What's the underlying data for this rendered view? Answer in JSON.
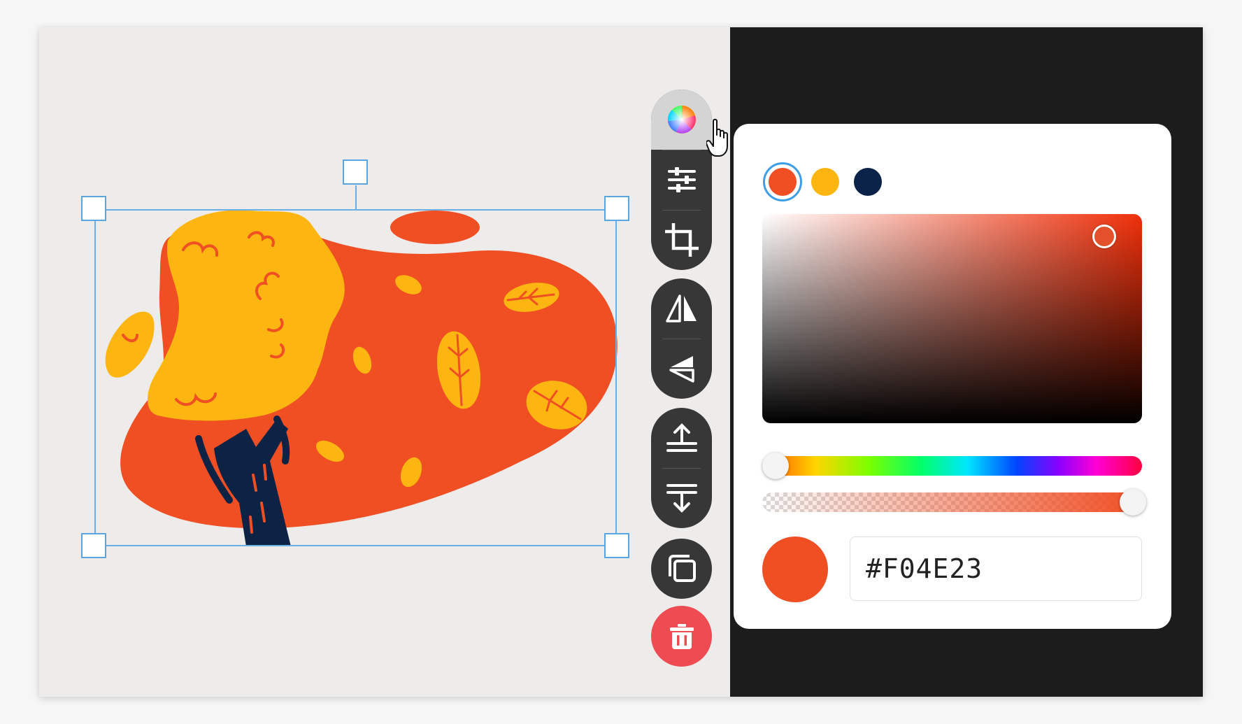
{
  "color_picker": {
    "swatches": [
      {
        "name": "orange",
        "color": "#F04E23",
        "selected": true
      },
      {
        "name": "yellow",
        "color": "#FDB611"
      },
      {
        "name": "navy",
        "color": "#0B2348"
      }
    ],
    "hex_value": "#F04E23",
    "current_color": "#F04E23",
    "hue_level": 0.0,
    "alpha_level": 1.0
  },
  "toolbar": {
    "tools": [
      {
        "id": "color",
        "icon": "color-wheel-icon",
        "active": true
      },
      {
        "id": "adjust",
        "icon": "sliders-icon"
      },
      {
        "id": "crop",
        "icon": "crop-icon"
      },
      {
        "id": "flip-horizontal",
        "icon": "flip-horizontal-icon"
      },
      {
        "id": "flip-vertical",
        "icon": "flip-vertical-icon"
      },
      {
        "id": "bring-forward",
        "icon": "bring-forward-icon"
      },
      {
        "id": "send-backward",
        "icon": "send-backward-icon"
      },
      {
        "id": "duplicate",
        "icon": "duplicate-icon"
      },
      {
        "id": "delete",
        "icon": "trash-icon"
      }
    ]
  },
  "colors": {
    "accent": "#3D9EE6",
    "selection": "#6AAEE3",
    "delete": "#EE4B52",
    "toolbar": "#373737"
  }
}
